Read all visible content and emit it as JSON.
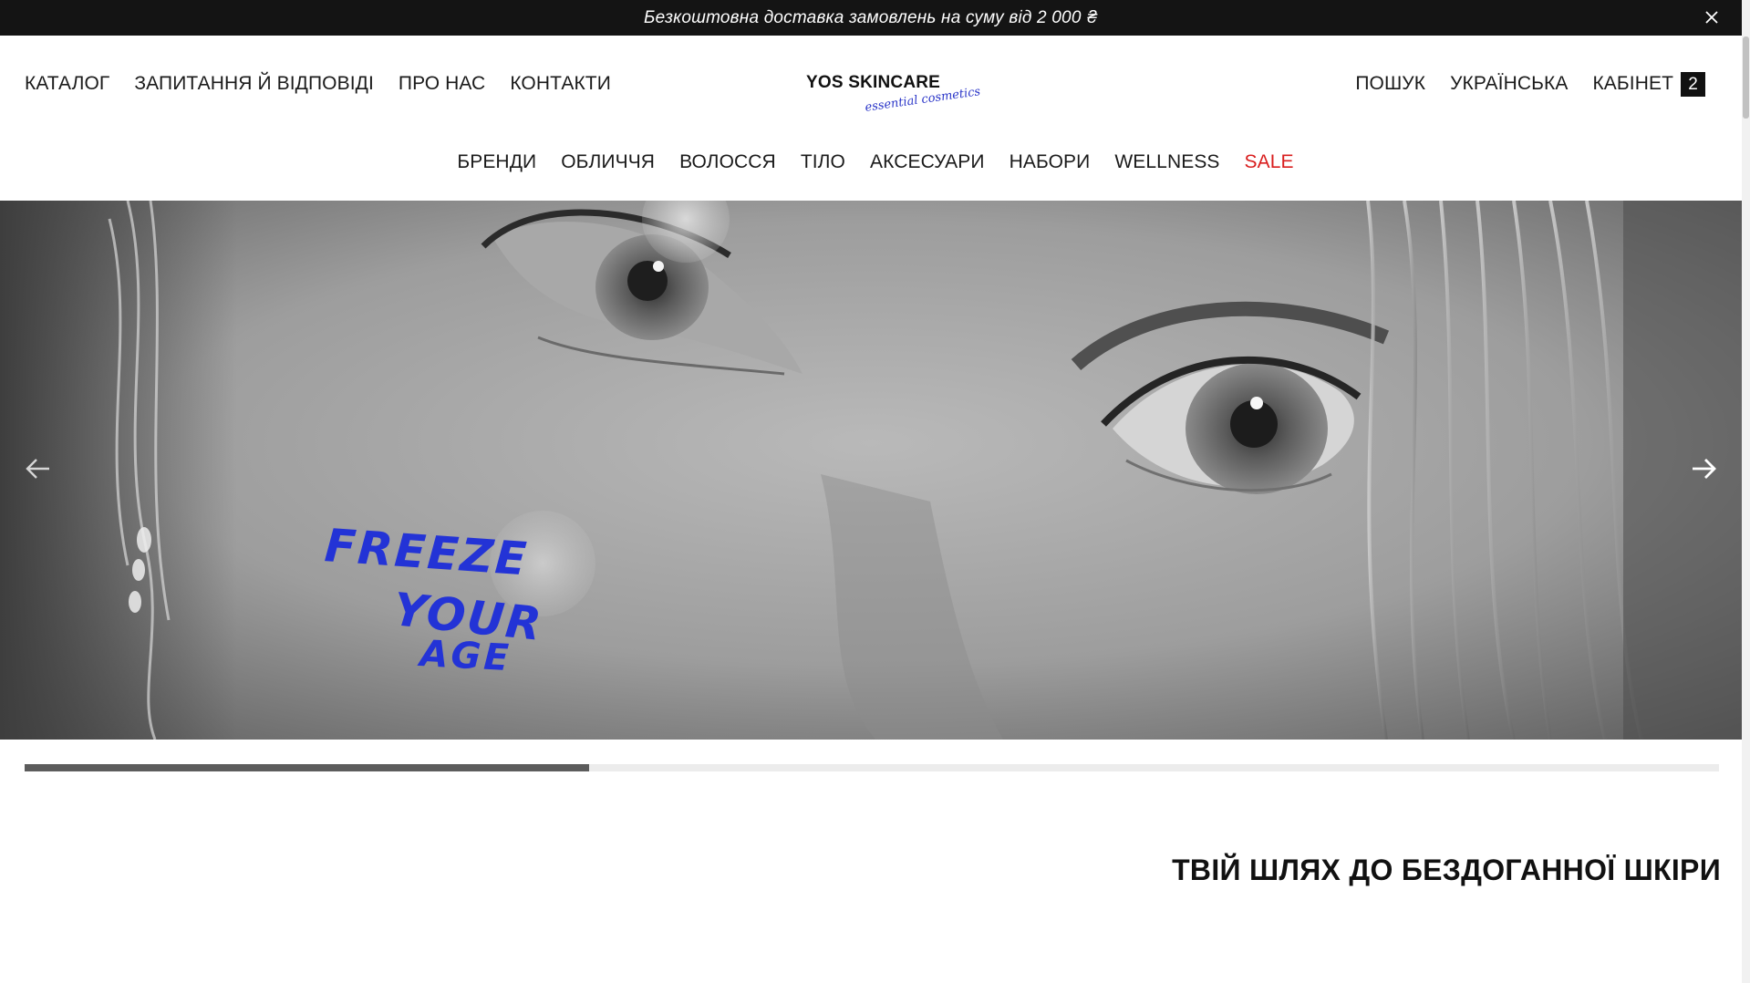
{
  "announcement": {
    "text": "Безкоштовна доставка замовлень на суму від 2 000 ₴",
    "close_icon": "close-icon"
  },
  "header": {
    "nav_left": [
      "КАТАЛОГ",
      "ЗАПИТАННЯ Й ВІДПОВІДІ",
      "ПРО НАС",
      "КОНТАКТИ"
    ],
    "logo": {
      "title": "YOS SKINCARE",
      "subtitle": "essential cosmetics",
      "subtitle_color": "#2a35c8"
    },
    "nav_right": [
      "ПОШУК",
      "УКРАЇНСЬКА",
      "КАБІНЕТ"
    ],
    "cart_count": "2",
    "categories": [
      "БРЕНДИ",
      "ОБЛИЧЧЯ",
      "ВОЛОССЯ",
      "ТІЛО",
      "АКСЕСУАРИ",
      "НАБОРИ",
      "WELLNESS",
      "SALE"
    ],
    "sale_color": "#d91e1e"
  },
  "hero": {
    "overlay_lines": [
      "FREEZE",
      "YOUR",
      "AGE"
    ],
    "overlay_color": "#2333d6",
    "prev_icon": "arrow-left-icon",
    "next_icon": "arrow-right-icon"
  },
  "slider": {
    "progress_fraction": 0.333
  },
  "section": {
    "title": "ТВІЙ ШЛЯХ ДО БЕЗДОГАННОЇ ШКІРИ"
  }
}
